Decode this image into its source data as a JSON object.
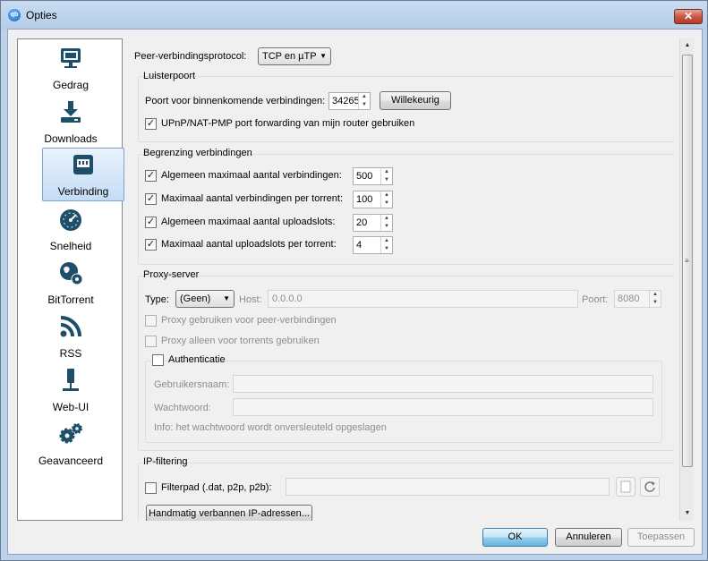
{
  "window": {
    "title": "Opties",
    "app_icon": "qb",
    "close_label": "✕"
  },
  "sidebar": {
    "items": [
      {
        "label": "Gedrag",
        "icon": "monitor-icon"
      },
      {
        "label": "Downloads",
        "icon": "download-icon"
      },
      {
        "label": "Verbinding",
        "icon": "network-icon",
        "selected": true
      },
      {
        "label": "Snelheid",
        "icon": "speedometer-icon"
      },
      {
        "label": "BitTorrent",
        "icon": "globe-gear-icon"
      },
      {
        "label": "RSS",
        "icon": "rss-icon"
      },
      {
        "label": "Web-UI",
        "icon": "plug-icon"
      },
      {
        "label": "Geavanceerd",
        "icon": "gears-icon"
      }
    ]
  },
  "protocol": {
    "label": "Peer-verbindingsprotocol:",
    "value": "TCP en µTP"
  },
  "listen": {
    "title": "Luisterpoort",
    "port_label": "Poort voor binnenkomende verbindingen:",
    "port_value": "34265",
    "random_button": "Willekeurig",
    "upnp_label": "UPnP/NAT-PMP port forwarding van mijn router gebruiken",
    "upnp_checked": true
  },
  "limits": {
    "title": "Begrenzing verbindingen",
    "rows": [
      {
        "label": "Algemeen maximaal aantal verbindingen:",
        "value": "500",
        "checked": true
      },
      {
        "label": "Maximaal aantal verbindingen per torrent:",
        "value": "100",
        "checked": true
      },
      {
        "label": "Algemeen maximaal aantal uploadslots:",
        "value": "20",
        "checked": true
      },
      {
        "label": "Maximaal aantal uploadslots per torrent:",
        "value": "4",
        "checked": true
      }
    ]
  },
  "proxy": {
    "title": "Proxy-server",
    "type_label": "Type:",
    "type_value": "(Geen)",
    "host_label": "Host:",
    "host_value": "0.0.0.0",
    "port_label": "Poort:",
    "port_value": "8080",
    "peer_label": "Proxy gebruiken voor peer-verbindingen",
    "torrents_only_label": "Proxy alleen voor torrents gebruiken",
    "auth_title": "Authenticatie",
    "username_label": "Gebruikersnaam:",
    "password_label": "Wachtwoord:",
    "info_text": "Info: het wachtwoord wordt onversleuteld opgeslagen"
  },
  "ipfilter": {
    "title": "IP-filtering",
    "filter_label": "Filterpad (.dat, p2p, p2b):",
    "banned_button": "Handmatig verbannen IP-adressen..."
  },
  "footer": {
    "ok": "OK",
    "cancel": "Annuleren",
    "apply": "Toepassen"
  }
}
